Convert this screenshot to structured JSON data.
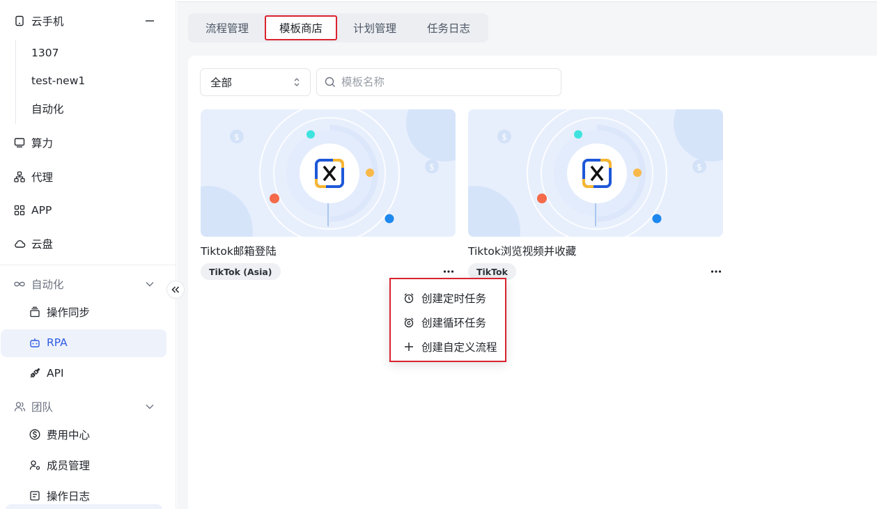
{
  "sidebar": {
    "cloud_phone": "云手机",
    "phones": [
      "1307",
      "test-new1",
      "自动化"
    ],
    "compute": "算力",
    "proxy": "代理",
    "app": "APP",
    "cloud_disk": "云盘",
    "automation": "自动化",
    "automation_items": [
      "操作同步",
      "RPA",
      "API"
    ],
    "team": "团队",
    "team_items": [
      "费用中心",
      "成员管理",
      "操作日志"
    ]
  },
  "tabs": [
    "流程管理",
    "模板商店",
    "计划管理",
    "任务日志"
  ],
  "active_tab": "模板商店",
  "filter": {
    "select_value": "全部",
    "search_placeholder": "模板名称",
    "search_value": ""
  },
  "cards": [
    {
      "title": "Tiktok邮箱登陆",
      "tag": "TikTok (Asia)"
    },
    {
      "title": "Tiktok浏览视频并收藏",
      "tag": "TikTok"
    }
  ],
  "menu": {
    "items": [
      "创建定时任务",
      "创建循环任务",
      "创建自定义流程"
    ]
  },
  "colors": {
    "accent": "#2f5be3",
    "highlight_border": "#d9232e",
    "banner_bg": "#e8effc"
  }
}
